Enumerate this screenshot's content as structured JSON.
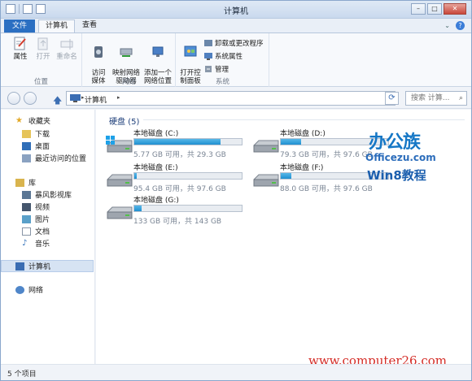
{
  "window": {
    "title": "计算机"
  },
  "tabs": {
    "file": "文件",
    "computer": "计算机",
    "view": "查看"
  },
  "ribbon": {
    "location": {
      "label": "位置",
      "properties": "属性",
      "open": "打开",
      "rename": "重命名"
    },
    "network": {
      "label": "网络",
      "access_media": "访问\n媒体",
      "map_drive": "映射网络\n驱动器",
      "add_location": "添加一个\n网络位置"
    },
    "system": {
      "label": "系统",
      "control_panel": "打开控\n制面板",
      "uninstall": "卸载或更改程序",
      "sys_props": "系统属性",
      "manage": "管理"
    }
  },
  "address": {
    "crumb": "计算机",
    "search_placeholder": "搜索 计算..."
  },
  "nav": {
    "favorites": "收藏夹",
    "downloads": "下载",
    "desktop": "桌面",
    "recent": "最近访问的位置",
    "libraries": "库",
    "storm": "暴风影视库",
    "videos": "视频",
    "pictures": "图片",
    "documents": "文档",
    "music": "音乐",
    "computer": "计算机",
    "network": "网络"
  },
  "content": {
    "group_title": "硬盘 (5)",
    "drives": [
      {
        "name": "本地磁盘 (C:)",
        "free": "5.77 GB 可用，共 29.3 GB",
        "used_fraction": 0.8,
        "system": true
      },
      {
        "name": "本地磁盘 (D:)",
        "free": "79.3 GB 可用，共 97.6 GB",
        "used_fraction": 0.19
      },
      {
        "name": "本地磁盘 (E:)",
        "free": "95.4 GB 可用，共 97.6 GB",
        "used_fraction": 0.02
      },
      {
        "name": "本地磁盘 (F:)",
        "free": "88.0 GB 可用，共 97.6 GB",
        "used_fraction": 0.1
      },
      {
        "name": "本地磁盘 (G:)",
        "free": "133 GB 可用，共 143 GB",
        "used_fraction": 0.07
      }
    ]
  },
  "watermark": {
    "logo_cn": "办公族",
    "logo_url": "Officezu.com",
    "logo_sub": "Win8教程",
    "site": "www.computer26.com"
  },
  "status": {
    "items": "5 个项目"
  },
  "colors": {
    "accent": "#2b6fc2",
    "bar_fill": "#1f8fd0",
    "watermark_red": "#d42c26"
  }
}
